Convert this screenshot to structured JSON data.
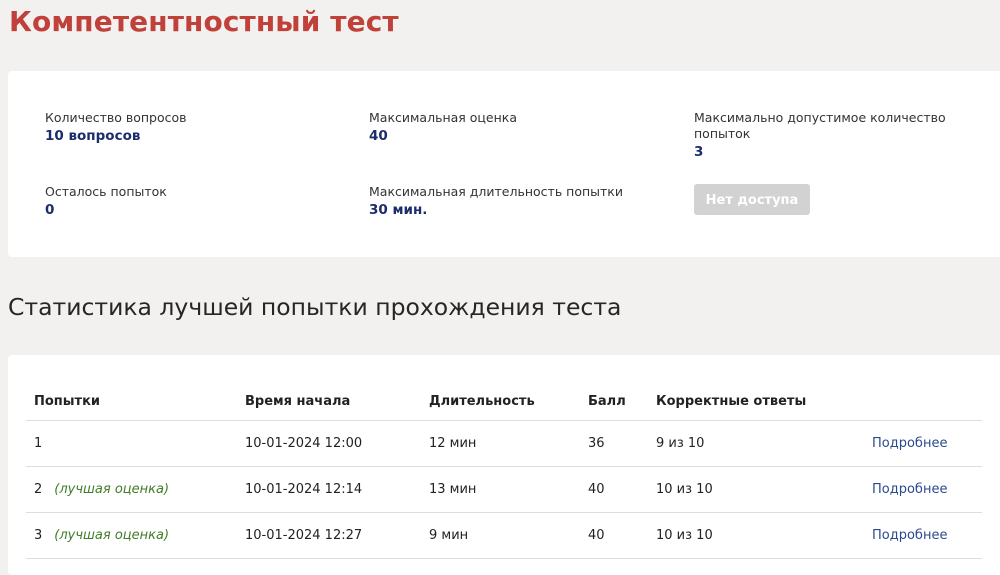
{
  "page_title": "Компетентностный тест",
  "info": {
    "questions_label": "Количество вопросов",
    "questions_value": "10 вопросов",
    "max_score_label": "Максимальная оценка",
    "max_score_value": "40",
    "max_attempts_label_line1": "Максимально допустимое количество",
    "max_attempts_label_line2": "попыток",
    "max_attempts_value": "3",
    "attempts_left_label": "Осталось попыток",
    "attempts_left_value": "0",
    "max_duration_label": "Максимальная длительность попытки",
    "max_duration_value": "30 мин.",
    "no_access_button": "Нет доступа"
  },
  "stats": {
    "title": "Статистика лучшей попытки прохождения теста",
    "columns": [
      "Попытки",
      "Время начала",
      "Длительность",
      "Балл",
      "Корректные ответы",
      ""
    ],
    "rows": [
      {
        "attempt": "1",
        "note": "",
        "start": "10-01-2024 12:00",
        "duration": "12 мин",
        "score": "36",
        "correct": "9 из 10",
        "link": "Подробнее"
      },
      {
        "attempt": "2",
        "note": "(лучшая оценка)",
        "start": "10-01-2024 12:14",
        "duration": "13 мин",
        "score": "40",
        "correct": "10 из 10",
        "link": "Подробнее"
      },
      {
        "attempt": "3",
        "note": "(лучшая оценка)",
        "start": "10-01-2024 12:27",
        "duration": "9 мин",
        "score": "40",
        "correct": "10 из 10",
        "link": "Подробнее"
      }
    ]
  },
  "colors": {
    "title_red": "#c0403a",
    "value_navy": "#1c2d6b",
    "best_green": "#3f7d28",
    "link_blue": "#2b4a8c",
    "disabled_gray": "#d2d2d2"
  }
}
